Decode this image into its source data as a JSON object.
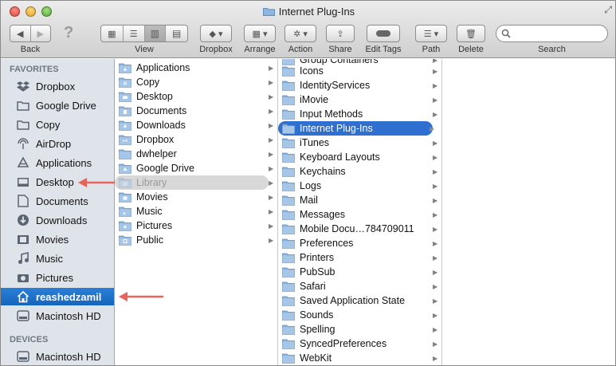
{
  "window": {
    "title": "Internet Plug-Ins"
  },
  "colors": {
    "selection": "#2f6fd0",
    "sidebar_selection": "#1e6fca",
    "annotation_arrow": "#e8635b"
  },
  "toolbar": {
    "back_label": "Back",
    "view_label": "View",
    "dropbox_label": "Dropbox",
    "arrange_label": "Arrange",
    "action_label": "Action",
    "share_label": "Share",
    "edit_tags_label": "Edit Tags",
    "path_label": "Path",
    "delete_label": "Delete",
    "search_label": "Search",
    "search_placeholder": ""
  },
  "sidebar": {
    "favorites_header": "FAVORITES",
    "devices_header": "DEVICES",
    "favorites": [
      {
        "label": "Dropbox",
        "icon": "dropbox-icon"
      },
      {
        "label": "Google Drive",
        "icon": "folder-icon"
      },
      {
        "label": "Copy",
        "icon": "folder-icon"
      },
      {
        "label": "AirDrop",
        "icon": "airdrop-icon"
      },
      {
        "label": "Applications",
        "icon": "applications-icon"
      },
      {
        "label": "Desktop",
        "icon": "desktop-icon"
      },
      {
        "label": "Documents",
        "icon": "documents-icon"
      },
      {
        "label": "Downloads",
        "icon": "downloads-icon"
      },
      {
        "label": "Movies",
        "icon": "movies-icon"
      },
      {
        "label": "Music",
        "icon": "music-icon"
      },
      {
        "label": "Pictures",
        "icon": "pictures-icon"
      },
      {
        "label": "reashedzamil",
        "icon": "home-icon",
        "selected": true
      },
      {
        "label": "Macintosh HD",
        "icon": "disk-icon"
      }
    ],
    "devices": [
      {
        "label": "Macintosh HD",
        "icon": "disk-icon"
      }
    ]
  },
  "column1": {
    "items": [
      {
        "label": "Applications",
        "has_children": true
      },
      {
        "label": "Copy",
        "has_children": true
      },
      {
        "label": "Desktop",
        "has_children": true
      },
      {
        "label": "Documents",
        "has_children": true
      },
      {
        "label": "Downloads",
        "has_children": true
      },
      {
        "label": "Dropbox",
        "has_children": true
      },
      {
        "label": "dwhelper",
        "has_children": true
      },
      {
        "label": "Google Drive",
        "has_children": true
      },
      {
        "label": "Library",
        "has_children": true,
        "state": "hidden-selected"
      },
      {
        "label": "Movies",
        "has_children": true
      },
      {
        "label": "Music",
        "has_children": true
      },
      {
        "label": "Pictures",
        "has_children": true
      },
      {
        "label": "Public",
        "has_children": true
      }
    ]
  },
  "column2": {
    "partial_top": "Group Containers",
    "items": [
      {
        "label": "Icons",
        "has_children": true
      },
      {
        "label": "IdentityServices",
        "has_children": true
      },
      {
        "label": "iMovie",
        "has_children": true
      },
      {
        "label": "Input Methods",
        "has_children": true
      },
      {
        "label": "Internet Plug-Ins",
        "has_children": true,
        "state": "selected"
      },
      {
        "label": "iTunes",
        "has_children": true
      },
      {
        "label": "Keyboard Layouts",
        "has_children": true
      },
      {
        "label": "Keychains",
        "has_children": true
      },
      {
        "label": "Logs",
        "has_children": true
      },
      {
        "label": "Mail",
        "has_children": true
      },
      {
        "label": "Messages",
        "has_children": true
      },
      {
        "label": "Mobile Docu…784709011",
        "has_children": true
      },
      {
        "label": "Preferences",
        "has_children": true
      },
      {
        "label": "Printers",
        "has_children": true
      },
      {
        "label": "PubSub",
        "has_children": true
      },
      {
        "label": "Safari",
        "has_children": true
      },
      {
        "label": "Saved Application State",
        "has_children": true
      },
      {
        "label": "Sounds",
        "has_children": true
      },
      {
        "label": "Spelling",
        "has_children": true
      },
      {
        "label": "SyncedPreferences",
        "has_children": true
      },
      {
        "label": "WebKit",
        "has_children": true
      }
    ]
  }
}
